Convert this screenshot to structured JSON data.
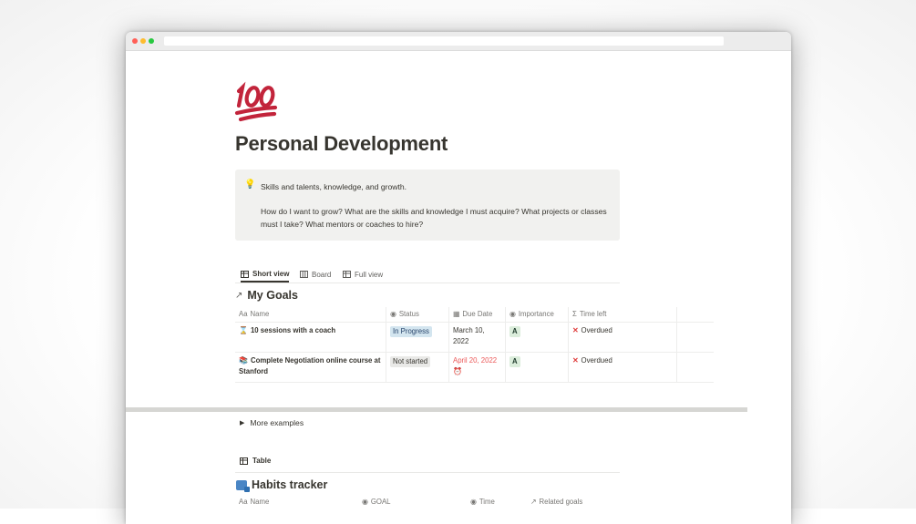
{
  "page": {
    "title": "Personal Development",
    "icon": "hundred-points-emoji"
  },
  "callout": {
    "icon": "lightbulb-icon",
    "line1": "Skills and talents, knowledge, and growth.",
    "line2": "How do I want to grow? What are the skills and knowledge I must acquire? What projects or classes must I take? What mentors or coaches to hire?"
  },
  "views": [
    {
      "label": "Short view",
      "icon": "table-icon",
      "active": true
    },
    {
      "label": "Board",
      "icon": "board-icon",
      "active": false
    },
    {
      "label": "Full view",
      "icon": "table-icon",
      "active": false
    }
  ],
  "goals": {
    "title": "My Goals",
    "columns": {
      "name": "Name",
      "name_icon": "Aa",
      "status": "Status",
      "due": "Due Date",
      "importance": "Importance",
      "time_left": "Time left",
      "time_icon": "Σ"
    },
    "rows": [
      {
        "icon": "hourglass-icon",
        "name": "10 sessions with a coach",
        "status": "In Progress",
        "due": "March 10, 2022",
        "importance": "A",
        "time_left": "Overdued"
      },
      {
        "icon": "books-icon",
        "name": "Complete Negotiation online course at Stanford",
        "status": "Not started",
        "due": "April 20, 2022",
        "importance": "A",
        "time_left": "Overdued"
      }
    ]
  },
  "more_examples": "More examples",
  "table_view": "Table",
  "habits": {
    "title": "Habits tracker",
    "columns": {
      "name": "Name",
      "name_icon": "Aa",
      "goal": "GOAL",
      "time": "Time",
      "related": "Related goals"
    }
  },
  "colors": {
    "accent_red": "#eb5757",
    "status_blue": "#d3e5ef",
    "importance_green": "#dbeddb"
  }
}
